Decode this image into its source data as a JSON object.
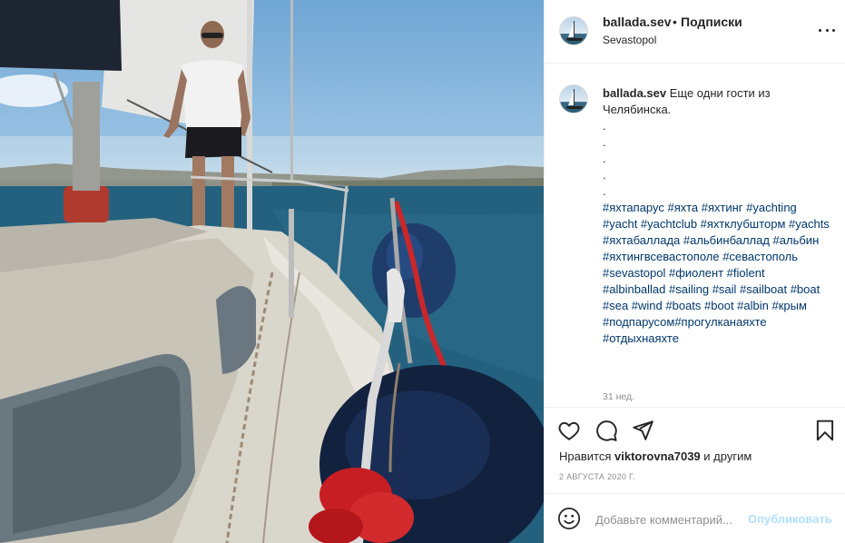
{
  "header": {
    "username": "ballada.sev",
    "separator": "•",
    "follow_label": "Подписки",
    "location": "Sevastopol"
  },
  "caption": {
    "username": "ballada.sev",
    "text": "Еще одни гости из Челябинска.",
    "dots": [
      ".",
      ".",
      ".",
      ".",
      "."
    ],
    "hashtags": "#яхтапарус #яхта #яхтинг #yachting #yacht #yachtclub #яхтклубшторм #yachts #яхтабаллада #альбинбаллад #альбин #яхтингвсевастополе #севастополь #sevastopol #фиолент #fiolent #albinballad #sailing #sail #sailboat #boat #sea #wind #boats #boot #albin #крым #подпарусом#прогулканаяхте #отдыхнаяхте",
    "age": "31 нед."
  },
  "actions": {
    "like_icon": "heart-icon",
    "comment_icon": "comment-icon",
    "share_icon": "paper-plane-icon",
    "save_icon": "bookmark-icon",
    "likes_prefix": "Нравится",
    "likes_user": "viktorovna7039",
    "likes_suffix": "и другим",
    "date": "2 АВГУСТА 2020 Г."
  },
  "add_comment": {
    "emoji_icon": "smiley-icon",
    "placeholder": "Добавьте комментарий...",
    "publish_label": "Опубликовать"
  },
  "colors": {
    "link": "#00376b",
    "muted": "#8e8e8e",
    "publish_disabled": "#b2dffc"
  }
}
